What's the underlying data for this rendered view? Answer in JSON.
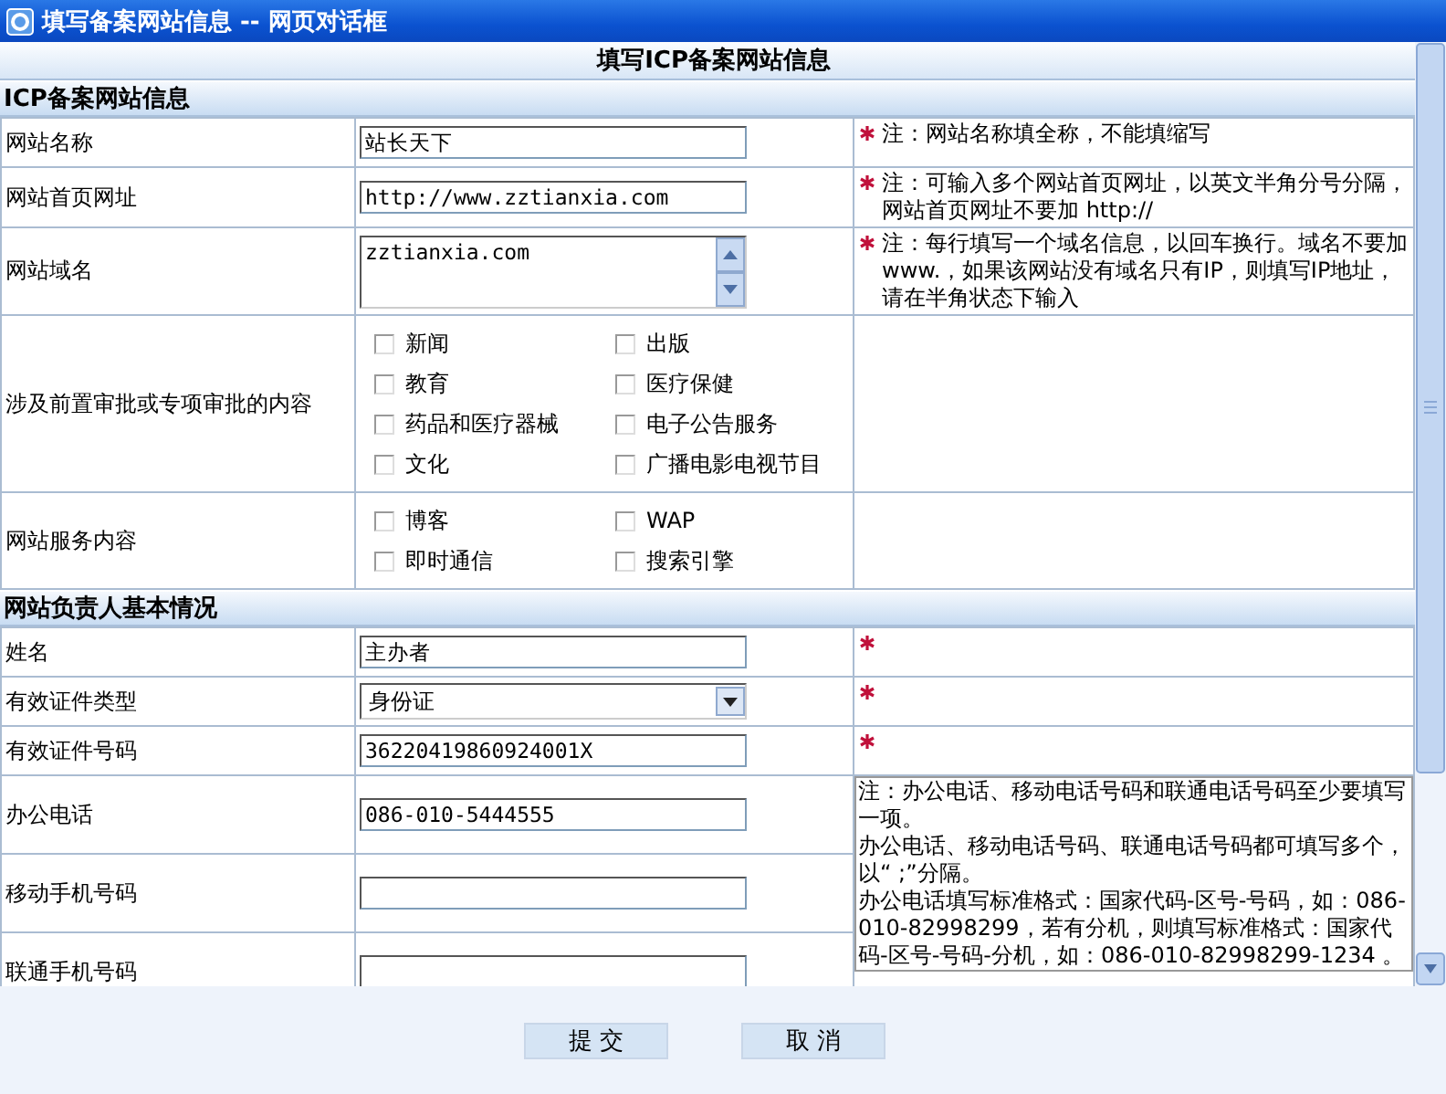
{
  "window": {
    "title": "填写备案网站信息 -- 网页对话框"
  },
  "header": "填写ICP备案网站信息",
  "sections": [
    {
      "title": "ICP备案网站信息",
      "rows": [
        {
          "kind": "text",
          "label": "网站名称",
          "value": "站长天下",
          "required": true,
          "note": "注：网站名称填全称，不能填缩写"
        },
        {
          "kind": "text",
          "label": "网站首页网址",
          "value": "http://www.zztianxia.com",
          "required": true,
          "note": "注：可输入多个网站首页网址，以英文半角分号分隔，网站首页网址不要加 http://"
        },
        {
          "kind": "textarea",
          "label": "网站域名",
          "value": "zztianxia.com",
          "required": true,
          "note": "注：每行填写一个域名信息，以回车换行。域名不要加 www.，如果该网站没有域名只有IP，则填写IP地址，请在半角状态下输入"
        },
        {
          "kind": "checkboxes",
          "label": "涉及前置审批或专项审批的内容",
          "options": [
            {
              "label": "新闻",
              "checked": false
            },
            {
              "label": "出版",
              "checked": false
            },
            {
              "label": "教育",
              "checked": false
            },
            {
              "label": "医疗保健",
              "checked": false
            },
            {
              "label": "药品和医疗器械",
              "checked": false
            },
            {
              "label": "电子公告服务",
              "checked": false
            },
            {
              "label": "文化",
              "checked": false
            },
            {
              "label": "广播电影电视节目",
              "checked": false
            }
          ]
        },
        {
          "kind": "checkboxes",
          "label": "网站服务内容",
          "options": [
            {
              "label": "博客",
              "checked": false
            },
            {
              "label": "WAP",
              "checked": false
            },
            {
              "label": "即时通信",
              "checked": false
            },
            {
              "label": "搜索引擎",
              "checked": false
            }
          ]
        }
      ]
    },
    {
      "title": "网站负责人基本情况",
      "rows": [
        {
          "kind": "text",
          "label": "姓名",
          "value": "主办者",
          "required": true
        },
        {
          "kind": "select",
          "label": "有效证件类型",
          "value": "身份证",
          "required": true
        },
        {
          "kind": "text",
          "label": "有效证件号码",
          "value": "36220419860924001X",
          "required": true
        },
        {
          "kind": "group",
          "notes": [
            "注：办公电话、移动电话号码和联通电话号码至少要填写一项。",
            "办公电话、移动电话号码、联通电话号码都可填写多个，以“ ;”分隔。",
            "办公电话填写标准格式：国家代码-区号-号码，如：086-010-82998299，若有分机，则填写标准格式：国家代码-区号-号码-分机，如：086-010-82998299-1234 。"
          ],
          "rows": [
            {
              "kind": "text",
              "label": "办公电话",
              "value": "086-010-5444555"
            },
            {
              "kind": "text",
              "label": "移动手机号码",
              "value": ""
            },
            {
              "kind": "text",
              "label": "联通手机号码",
              "value": ""
            }
          ]
        }
      ]
    }
  ],
  "buttons": [
    "提 交",
    "取 消"
  ]
}
